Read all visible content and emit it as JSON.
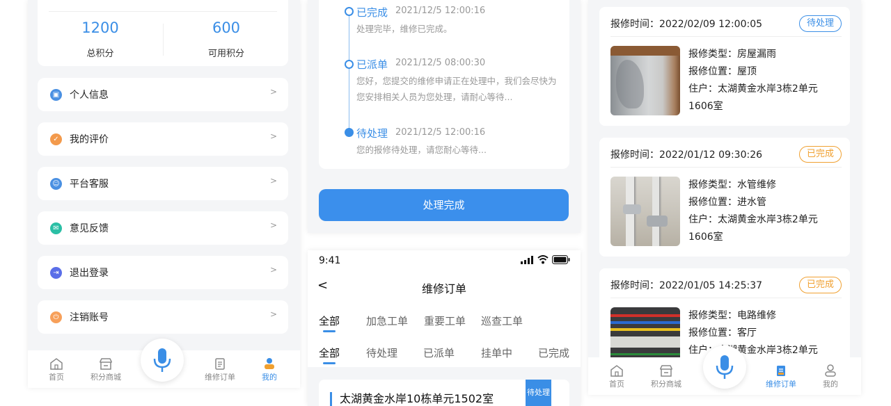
{
  "profile": {
    "total_points_value": "1200",
    "total_points_label": "总积分",
    "available_points_value": "600",
    "available_points_label": "可用积分",
    "menu": [
      {
        "label": "个人信息",
        "icon": "id-card-icon",
        "color": "#4a90e2",
        "arrow": ">"
      },
      {
        "label": "我的评价",
        "icon": "comment-icon",
        "color": "#f39a4c",
        "arrow": ">"
      },
      {
        "label": "平台客服",
        "icon": "headset-icon",
        "color": "#4a90e2",
        "arrow": ">"
      },
      {
        "label": "意见反馈",
        "icon": "feedback-icon",
        "color": "#2bbfa5",
        "arrow": ">"
      },
      {
        "label": "退出登录",
        "icon": "logout-icon",
        "color": "#5a6ee8",
        "arrow": ">"
      },
      {
        "label": "注销账号",
        "icon": "cancel-account-icon",
        "color": "#f7a05a",
        "arrow": ">"
      }
    ]
  },
  "tabbar": {
    "home": "首页",
    "mall": "积分商城",
    "orders": "维修订单",
    "mine": "我的"
  },
  "timeline": [
    {
      "status": "已完成",
      "time": "2021/12/5 12:00:16",
      "desc": "处理完毕，维修已完成。"
    },
    {
      "status": "已派单",
      "time": "2021/12/5 08:00:30",
      "desc": "您好，您提交的维修申请正在处理中，我们会尽快为您安排相关人员为您处理，请耐心等待..."
    },
    {
      "status": "待处理",
      "time": "2021/12/5 12:00:16",
      "desc": "您的报修待处理，请您耐心等待..."
    }
  ],
  "complete_button": "处理完成",
  "orders_screen": {
    "status_time": "9:41",
    "title": "维修订单",
    "back": "<",
    "type_tabs": [
      "全部",
      "加急工单",
      "重要工单",
      "巡查工单"
    ],
    "status_tabs": [
      "全部",
      "待处理",
      "已派单",
      "挂单中",
      "已完成"
    ],
    "first_order_address": "太湖黄金水岸10栋单元1502室",
    "first_order_badge": "待处理"
  },
  "orders": [
    {
      "time_label": "报修时间：",
      "time": "2022/02/09  12:00:05",
      "badge": "待处理",
      "badge_color": "#3a8ee6",
      "type": "报修类型：房屋漏雨",
      "location": "报修位置：屋顶",
      "resident": "住户：太湖黄金水岸3栋2单元1606室"
    },
    {
      "time_label": "报修时间：",
      "time": "2022/01/12  09:30:26",
      "badge": "已完成",
      "badge_color": "#f0a030",
      "type": "报修类型：水管维修",
      "location": "报修位置：进水管",
      "resident": "住户：太湖黄金水岸3栋2单元1606室"
    },
    {
      "time_label": "报修时间：",
      "time": "2022/01/05  14:25:37",
      "badge": "已完成",
      "badge_color": "#f0a030",
      "type": "报修类型：电路维修",
      "location": "报修位置：客厅",
      "resident": "住户：太湖黄金水岸3栋2单元"
    }
  ]
}
